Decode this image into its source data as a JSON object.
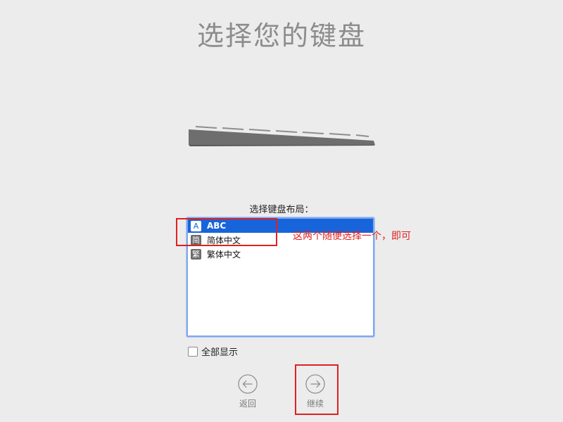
{
  "header": {
    "title": "选择您的键盘"
  },
  "layout_section": {
    "label": "选择键盘布局：",
    "items": [
      {
        "icon_glyph": "A",
        "icon_name": "letter-a-icon",
        "label": "ABC",
        "selected": true
      },
      {
        "icon_glyph": "简",
        "icon_name": "simplified-chinese-icon",
        "label": "简体中文",
        "selected": false
      },
      {
        "icon_glyph": "繁",
        "icon_name": "traditional-chinese-icon",
        "label": "繁体中文",
        "selected": false
      }
    ]
  },
  "show_all": {
    "label": "全部显示",
    "checked": false
  },
  "navigation": {
    "back_label": "返回",
    "continue_label": "继续"
  },
  "annotation": {
    "text": "这两个随便选择一个，即可"
  },
  "colors": {
    "selection": "#1864db",
    "list_border": "#7fa9ec",
    "annotation": "#e02020",
    "title": "#8c8c8c"
  }
}
